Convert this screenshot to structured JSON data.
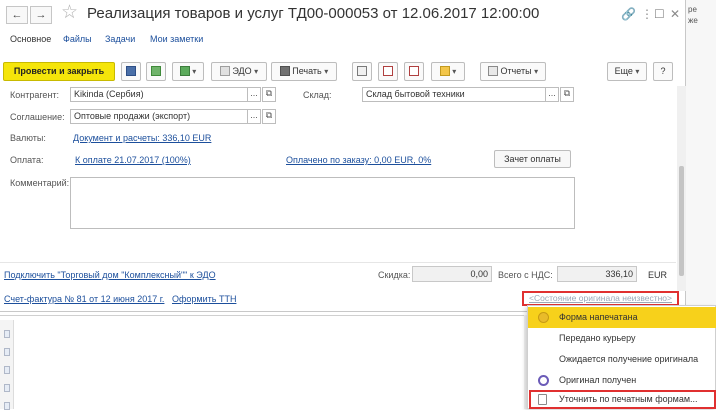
{
  "window": {
    "back_glyph": "←",
    "forward_glyph": "→",
    "favorite_glyph": "☆",
    "title": "Реализация товаров и услуг ТД00-000053 от 12.06.2017 12:00:00",
    "icons": {
      "link": "🔗",
      "more": "⋮",
      "maximize": "☐",
      "close": "✕"
    }
  },
  "tabs": [
    {
      "label": "Основное",
      "active": true
    },
    {
      "label": "Файлы"
    },
    {
      "label": "Задачи"
    },
    {
      "label": "Мои заметки"
    }
  ],
  "toolbar": {
    "post_close_label": "Провести и закрыть",
    "edo_label": "ЭДО",
    "print_label": "Печать",
    "reports_label": "Отчеты",
    "more_label": "Еще",
    "help_label": "?"
  },
  "form": {
    "counterparty_label": "Контрагент:",
    "counterparty_value": "Kikinda (Сербия)",
    "warehouse_label": "Склад:",
    "warehouse_value": "Склад бытовой техники",
    "agreement_label": "Соглашение:",
    "agreement_value": "Оптовые продажи (экспорт)",
    "currency_label": "Валюты:",
    "currency_link": "Документ и расчеты: 336,10 EUR",
    "payment_label": "Оплата:",
    "payment_link": "К оплате 21.07.2017 (100%)",
    "paid_link": "Оплачено по заказу: 0,00 EUR, 0%",
    "payment_offset_button": "Зачет оплаты",
    "comment_label": "Комментарий:",
    "field_btn_dots": "...",
    "field_btn_open": "⧉"
  },
  "footer": {
    "edo_link": "Подключить \"Торговый дом \"Комплексный\"\" к ЭДО",
    "discount_label": "Скидка:",
    "discount_value": "0,00",
    "total_label": "Всего с НДС:",
    "total_value": "336,10",
    "currency": "EUR",
    "invoice_link": "Счет-фактура № 81 от 12 июня 2017 г.",
    "ttn_link": "Оформить ТТН",
    "original_state_link": "<Состояние оригинала неизвестно>"
  },
  "dropdown_menu": {
    "items": [
      {
        "label": "Форма напечатана",
        "icon": "printed-circle-icon",
        "selected": true
      },
      {
        "label": "Передано курьеру"
      },
      {
        "label": "Ожидается получение оригинала"
      },
      {
        "label": "Оригинал получен",
        "icon": "received-circle-icon"
      },
      {
        "label": "Уточнить по печатным формам...",
        "icon": "document-icon",
        "highlighted": true
      }
    ]
  },
  "background": {
    "right_text": "ре\nже"
  },
  "colors": {
    "primary_button": "#f5e50a",
    "link": "#1c4f9c",
    "highlight_border": "#e03030",
    "menu_selected": "#f7d11b"
  }
}
